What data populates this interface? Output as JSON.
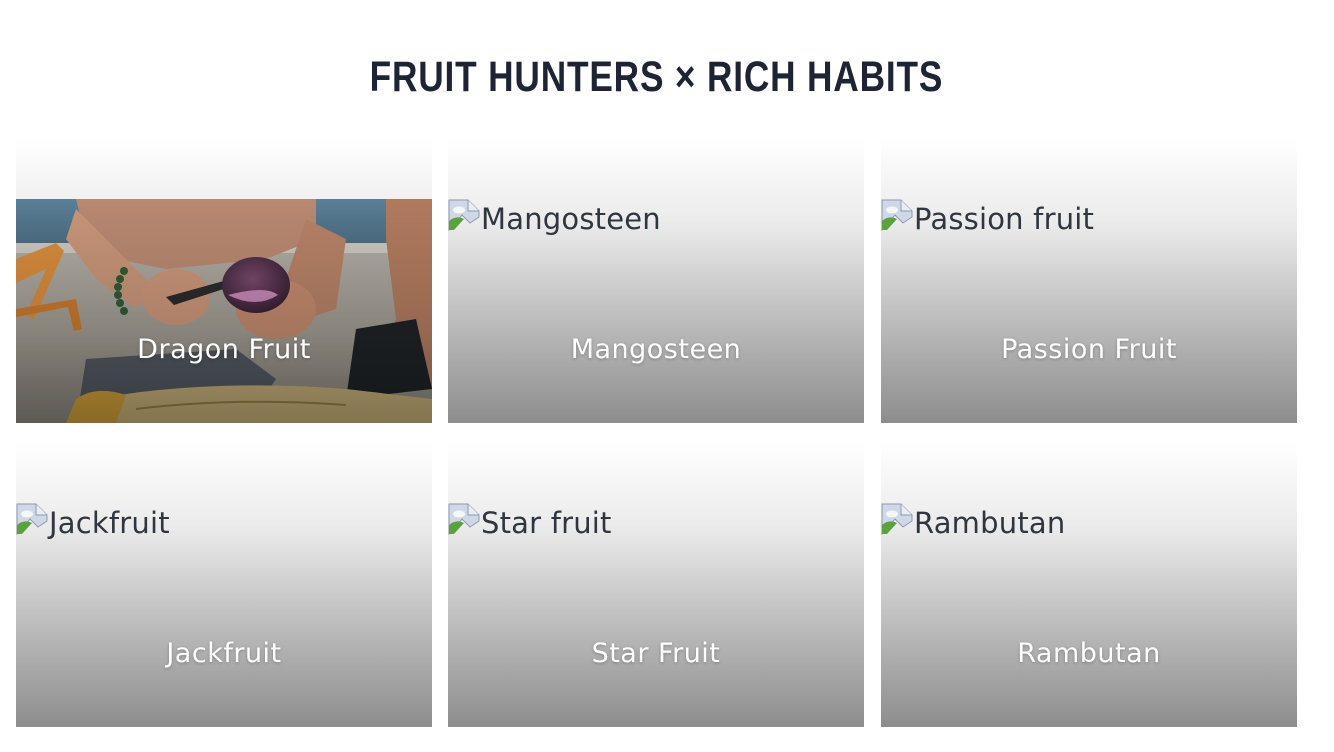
{
  "header": {
    "title": "FRUIT HUNTERS × RICH HABITS"
  },
  "cards": [
    {
      "label": "Dragon Fruit",
      "image_alt": "",
      "image_loaded": true
    },
    {
      "label": "Mangosteen",
      "image_alt": "Mangosteen",
      "image_loaded": false
    },
    {
      "label": "Passion Fruit",
      "image_alt": "Passion fruit",
      "image_loaded": false
    },
    {
      "label": "Jackfruit",
      "image_alt": "Jackfruit",
      "image_loaded": false
    },
    {
      "label": "Star Fruit",
      "image_alt": "Star fruit",
      "image_loaded": false
    },
    {
      "label": "Rambutan",
      "image_alt": "Rambutan",
      "image_loaded": false
    }
  ],
  "colors": {
    "title": "#1e2433",
    "card_gradient_top": "#ffffff",
    "card_gradient_bottom": "#8d8d8d",
    "label": "#ffffff"
  }
}
